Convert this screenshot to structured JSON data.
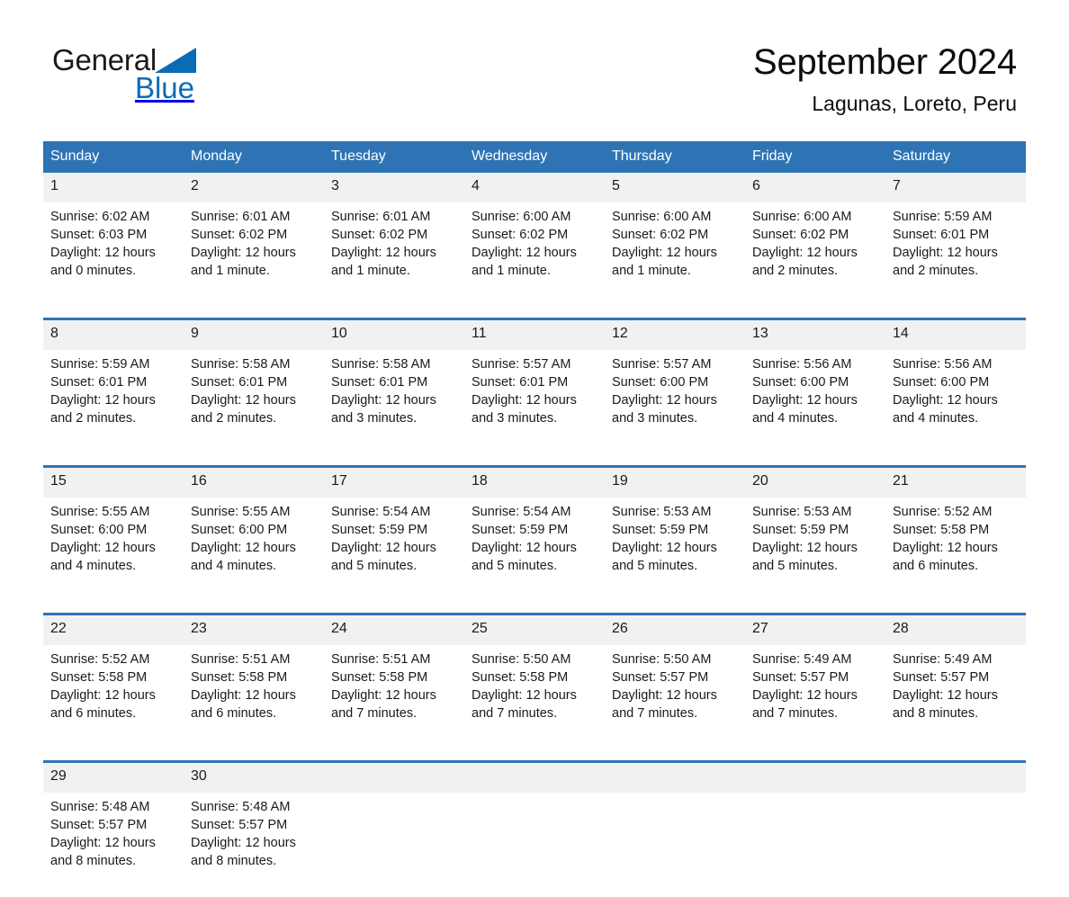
{
  "brand": {
    "name_part1": "General",
    "name_part2": "Blue",
    "logo_icon": "triangle-icon",
    "accent_color": "#0b6bb5"
  },
  "header": {
    "title": "September 2024",
    "subtitle": "Lagunas, Loreto, Peru"
  },
  "theme": {
    "header_blue": "#2e74b5",
    "daynum_gray": "#f1f1f1",
    "separator_blue": "#2e74b5"
  },
  "calendar": {
    "weekday_headers": [
      "Sunday",
      "Monday",
      "Tuesday",
      "Wednesday",
      "Thursday",
      "Friday",
      "Saturday"
    ],
    "weeks": [
      [
        {
          "day": "1",
          "sunrise": "Sunrise: 6:02 AM",
          "sunset": "Sunset: 6:03 PM",
          "daylight_line1": "Daylight: 12 hours",
          "daylight_line2": "and 0 minutes."
        },
        {
          "day": "2",
          "sunrise": "Sunrise: 6:01 AM",
          "sunset": "Sunset: 6:02 PM",
          "daylight_line1": "Daylight: 12 hours",
          "daylight_line2": "and 1 minute."
        },
        {
          "day": "3",
          "sunrise": "Sunrise: 6:01 AM",
          "sunset": "Sunset: 6:02 PM",
          "daylight_line1": "Daylight: 12 hours",
          "daylight_line2": "and 1 minute."
        },
        {
          "day": "4",
          "sunrise": "Sunrise: 6:00 AM",
          "sunset": "Sunset: 6:02 PM",
          "daylight_line1": "Daylight: 12 hours",
          "daylight_line2": "and 1 minute."
        },
        {
          "day": "5",
          "sunrise": "Sunrise: 6:00 AM",
          "sunset": "Sunset: 6:02 PM",
          "daylight_line1": "Daylight: 12 hours",
          "daylight_line2": "and 1 minute."
        },
        {
          "day": "6",
          "sunrise": "Sunrise: 6:00 AM",
          "sunset": "Sunset: 6:02 PM",
          "daylight_line1": "Daylight: 12 hours",
          "daylight_line2": "and 2 minutes."
        },
        {
          "day": "7",
          "sunrise": "Sunrise: 5:59 AM",
          "sunset": "Sunset: 6:01 PM",
          "daylight_line1": "Daylight: 12 hours",
          "daylight_line2": "and 2 minutes."
        }
      ],
      [
        {
          "day": "8",
          "sunrise": "Sunrise: 5:59 AM",
          "sunset": "Sunset: 6:01 PM",
          "daylight_line1": "Daylight: 12 hours",
          "daylight_line2": "and 2 minutes."
        },
        {
          "day": "9",
          "sunrise": "Sunrise: 5:58 AM",
          "sunset": "Sunset: 6:01 PM",
          "daylight_line1": "Daylight: 12 hours",
          "daylight_line2": "and 2 minutes."
        },
        {
          "day": "10",
          "sunrise": "Sunrise: 5:58 AM",
          "sunset": "Sunset: 6:01 PM",
          "daylight_line1": "Daylight: 12 hours",
          "daylight_line2": "and 3 minutes."
        },
        {
          "day": "11",
          "sunrise": "Sunrise: 5:57 AM",
          "sunset": "Sunset: 6:01 PM",
          "daylight_line1": "Daylight: 12 hours",
          "daylight_line2": "and 3 minutes."
        },
        {
          "day": "12",
          "sunrise": "Sunrise: 5:57 AM",
          "sunset": "Sunset: 6:00 PM",
          "daylight_line1": "Daylight: 12 hours",
          "daylight_line2": "and 3 minutes."
        },
        {
          "day": "13",
          "sunrise": "Sunrise: 5:56 AM",
          "sunset": "Sunset: 6:00 PM",
          "daylight_line1": "Daylight: 12 hours",
          "daylight_line2": "and 4 minutes."
        },
        {
          "day": "14",
          "sunrise": "Sunrise: 5:56 AM",
          "sunset": "Sunset: 6:00 PM",
          "daylight_line1": "Daylight: 12 hours",
          "daylight_line2": "and 4 minutes."
        }
      ],
      [
        {
          "day": "15",
          "sunrise": "Sunrise: 5:55 AM",
          "sunset": "Sunset: 6:00 PM",
          "daylight_line1": "Daylight: 12 hours",
          "daylight_line2": "and 4 minutes."
        },
        {
          "day": "16",
          "sunrise": "Sunrise: 5:55 AM",
          "sunset": "Sunset: 6:00 PM",
          "daylight_line1": "Daylight: 12 hours",
          "daylight_line2": "and 4 minutes."
        },
        {
          "day": "17",
          "sunrise": "Sunrise: 5:54 AM",
          "sunset": "Sunset: 5:59 PM",
          "daylight_line1": "Daylight: 12 hours",
          "daylight_line2": "and 5 minutes."
        },
        {
          "day": "18",
          "sunrise": "Sunrise: 5:54 AM",
          "sunset": "Sunset: 5:59 PM",
          "daylight_line1": "Daylight: 12 hours",
          "daylight_line2": "and 5 minutes."
        },
        {
          "day": "19",
          "sunrise": "Sunrise: 5:53 AM",
          "sunset": "Sunset: 5:59 PM",
          "daylight_line1": "Daylight: 12 hours",
          "daylight_line2": "and 5 minutes."
        },
        {
          "day": "20",
          "sunrise": "Sunrise: 5:53 AM",
          "sunset": "Sunset: 5:59 PM",
          "daylight_line1": "Daylight: 12 hours",
          "daylight_line2": "and 5 minutes."
        },
        {
          "day": "21",
          "sunrise": "Sunrise: 5:52 AM",
          "sunset": "Sunset: 5:58 PM",
          "daylight_line1": "Daylight: 12 hours",
          "daylight_line2": "and 6 minutes."
        }
      ],
      [
        {
          "day": "22",
          "sunrise": "Sunrise: 5:52 AM",
          "sunset": "Sunset: 5:58 PM",
          "daylight_line1": "Daylight: 12 hours",
          "daylight_line2": "and 6 minutes."
        },
        {
          "day": "23",
          "sunrise": "Sunrise: 5:51 AM",
          "sunset": "Sunset: 5:58 PM",
          "daylight_line1": "Daylight: 12 hours",
          "daylight_line2": "and 6 minutes."
        },
        {
          "day": "24",
          "sunrise": "Sunrise: 5:51 AM",
          "sunset": "Sunset: 5:58 PM",
          "daylight_line1": "Daylight: 12 hours",
          "daylight_line2": "and 7 minutes."
        },
        {
          "day": "25",
          "sunrise": "Sunrise: 5:50 AM",
          "sunset": "Sunset: 5:58 PM",
          "daylight_line1": "Daylight: 12 hours",
          "daylight_line2": "and 7 minutes."
        },
        {
          "day": "26",
          "sunrise": "Sunrise: 5:50 AM",
          "sunset": "Sunset: 5:57 PM",
          "daylight_line1": "Daylight: 12 hours",
          "daylight_line2": "and 7 minutes."
        },
        {
          "day": "27",
          "sunrise": "Sunrise: 5:49 AM",
          "sunset": "Sunset: 5:57 PM",
          "daylight_line1": "Daylight: 12 hours",
          "daylight_line2": "and 7 minutes."
        },
        {
          "day": "28",
          "sunrise": "Sunrise: 5:49 AM",
          "sunset": "Sunset: 5:57 PM",
          "daylight_line1": "Daylight: 12 hours",
          "daylight_line2": "and 8 minutes."
        }
      ],
      [
        {
          "day": "29",
          "sunrise": "Sunrise: 5:48 AM",
          "sunset": "Sunset: 5:57 PM",
          "daylight_line1": "Daylight: 12 hours",
          "daylight_line2": "and 8 minutes."
        },
        {
          "day": "30",
          "sunrise": "Sunrise: 5:48 AM",
          "sunset": "Sunset: 5:57 PM",
          "daylight_line1": "Daylight: 12 hours",
          "daylight_line2": "and 8 minutes."
        },
        {
          "day": "",
          "sunrise": "",
          "sunset": "",
          "daylight_line1": "",
          "daylight_line2": ""
        },
        {
          "day": "",
          "sunrise": "",
          "sunset": "",
          "daylight_line1": "",
          "daylight_line2": ""
        },
        {
          "day": "",
          "sunrise": "",
          "sunset": "",
          "daylight_line1": "",
          "daylight_line2": ""
        },
        {
          "day": "",
          "sunrise": "",
          "sunset": "",
          "daylight_line1": "",
          "daylight_line2": ""
        },
        {
          "day": "",
          "sunrise": "",
          "sunset": "",
          "daylight_line1": "",
          "daylight_line2": ""
        }
      ]
    ]
  }
}
